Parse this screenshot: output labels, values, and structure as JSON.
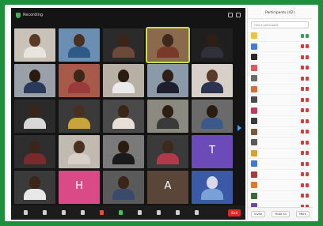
{
  "meeting": {
    "topbar": {
      "recording_label": "Recording",
      "icons": [
        "shield-icon",
        "info-icon",
        "view-icon"
      ]
    },
    "grid": [
      {
        "name": "",
        "head": "#5a3b28",
        "body": "#e8e4de",
        "bg": "#c9c2b8",
        "active": false
      },
      {
        "name": "",
        "head": "#4a3020",
        "body": "#2e5a88",
        "bg": "#6b8fb3",
        "active": false
      },
      {
        "name": "",
        "head": "#3a2518",
        "body": "#6b4a3a",
        "bg": "#2b2b2b",
        "active": false
      },
      {
        "name": "",
        "head": "#3d2a1c",
        "body": "#7a3a2a",
        "bg": "#8a6a4a",
        "active": true
      },
      {
        "name": "",
        "head": "#2e1f15",
        "body": "#30303a",
        "bg": "#1f1f1f",
        "active": false
      },
      {
        "name": "",
        "head": "#2a1b10",
        "body": "#2a3a5a",
        "bg": "#9aa0a8",
        "active": false
      },
      {
        "name": "",
        "head": "#3a2718",
        "body": "#9b3a3a",
        "bg": "#a55a4a",
        "active": false
      },
      {
        "name": "",
        "head": "#2b1c12",
        "body": "#eaeaea",
        "bg": "#b8b0a4",
        "active": false
      },
      {
        "name": "",
        "head": "#2e2016",
        "body": "#1e1e2e",
        "bg": "#8a9aa8",
        "active": false
      },
      {
        "name": "",
        "head": "#5b3a2a",
        "body": "#2b3550",
        "bg": "#d6d0c8",
        "active": false
      },
      {
        "name": "",
        "head": "#3a2518",
        "body": "#d8d8d8",
        "bg": "#2a2a2a",
        "active": false
      },
      {
        "name": "",
        "head": "#4a2e1e",
        "body": "#c9a43a",
        "bg": "#3a3a3a",
        "active": false
      },
      {
        "name": "",
        "head": "#3a2518",
        "body": "#e8e0d8",
        "bg": "#4a4a4a",
        "active": false
      },
      {
        "name": "",
        "head": "#2e1e14",
        "body": "#3a3a3a",
        "bg": "#8a8a80",
        "active": false
      },
      {
        "name": "",
        "head": "#2b1c12",
        "body": "#3a5a8a",
        "bg": "#6a6a6a",
        "active": false
      },
      {
        "name": "",
        "head": "#3a2518",
        "body": "#7a2a2a",
        "bg": "#2e2e2e",
        "active": false
      },
      {
        "name": "",
        "head": "#4a3020",
        "body": "#d8d0c8",
        "bg": "#c0bab0",
        "active": false
      },
      {
        "name": "",
        "head": "#2b1c12",
        "body": "#1a1a1a",
        "bg": "#7a7a7a",
        "active": false
      },
      {
        "name": "",
        "head": "#3d2a1c",
        "body": "#b03a4a",
        "bg": "#3a3a3a",
        "active": false
      },
      {
        "name": "",
        "letter": "T",
        "bg": "#6b4bb8",
        "active": false
      },
      {
        "name": "",
        "head": "#3a2518",
        "body": "#e8e8e8",
        "bg": "#3a3a3a",
        "active": false
      },
      {
        "name": "",
        "letter": "H",
        "bg": "#d94a86",
        "active": false
      },
      {
        "name": "",
        "head": "#3a2518",
        "body": "#3a4a6a",
        "bg": "#5a5a5a",
        "active": false
      },
      {
        "name": "",
        "letter": "A",
        "bg": "#5a4638",
        "active": false
      },
      {
        "name": "",
        "head": "#d8d8e8",
        "body": "#7aa0d8",
        "bg": "#3a5aa8",
        "active": false
      }
    ],
    "toolbar": {
      "items": [
        {
          "icon": "mic-icon",
          "kind": "plain"
        },
        {
          "icon": "video-icon",
          "kind": "plain"
        },
        {
          "icon": "security-icon",
          "kind": "plain"
        },
        {
          "icon": "participants-icon",
          "kind": "plain"
        },
        {
          "icon": "chat-icon",
          "kind": "red"
        },
        {
          "icon": "share-screen-icon",
          "kind": "green"
        },
        {
          "icon": "record-icon",
          "kind": "plain"
        },
        {
          "icon": "breakout-icon",
          "kind": "plain"
        },
        {
          "icon": "reactions-icon",
          "kind": "plain"
        },
        {
          "icon": "apps-icon",
          "kind": "plain"
        }
      ],
      "end_label": "End"
    }
  },
  "panel": {
    "title": "Participants (42)",
    "search_placeholder": "Find a participant",
    "participants": [
      {
        "name": "",
        "avatar": "#f2c230",
        "icon": "green"
      },
      {
        "name": "",
        "avatar": "#3f7fd6",
        "icon": "red"
      },
      {
        "name": "",
        "avatar": "#2a2a2a",
        "icon": "red"
      },
      {
        "name": "",
        "avatar": "#e05a5a",
        "icon": "red"
      },
      {
        "name": "",
        "avatar": "#6b6b6b",
        "icon": "red"
      },
      {
        "name": "",
        "avatar": "#d96a3a",
        "icon": "red"
      },
      {
        "name": "",
        "avatar": "#4a4a4a",
        "icon": "red"
      },
      {
        "name": "",
        "avatar": "#c23a5a",
        "icon": "red"
      },
      {
        "name": "",
        "avatar": "#3a3a3a",
        "icon": "red"
      },
      {
        "name": "",
        "avatar": "#7a5a3a",
        "icon": "red"
      },
      {
        "name": "",
        "avatar": "#5a5a5a",
        "icon": "red"
      },
      {
        "name": "",
        "avatar": "#d8a030",
        "icon": "red"
      },
      {
        "name": "",
        "avatar": "#3a7ad8",
        "icon": "red"
      },
      {
        "name": "",
        "avatar": "#aa3a3a",
        "icon": "red"
      },
      {
        "name": "",
        "avatar": "#e07a2a",
        "icon": "red"
      },
      {
        "name": "",
        "avatar": "#3a6a3a",
        "icon": "red"
      },
      {
        "name": "",
        "avatar": "#6a4aa8",
        "icon": "red"
      }
    ],
    "bottom": {
      "invite_label": "Invite",
      "mute_all_label": "Mute All",
      "more_label": "More"
    }
  }
}
